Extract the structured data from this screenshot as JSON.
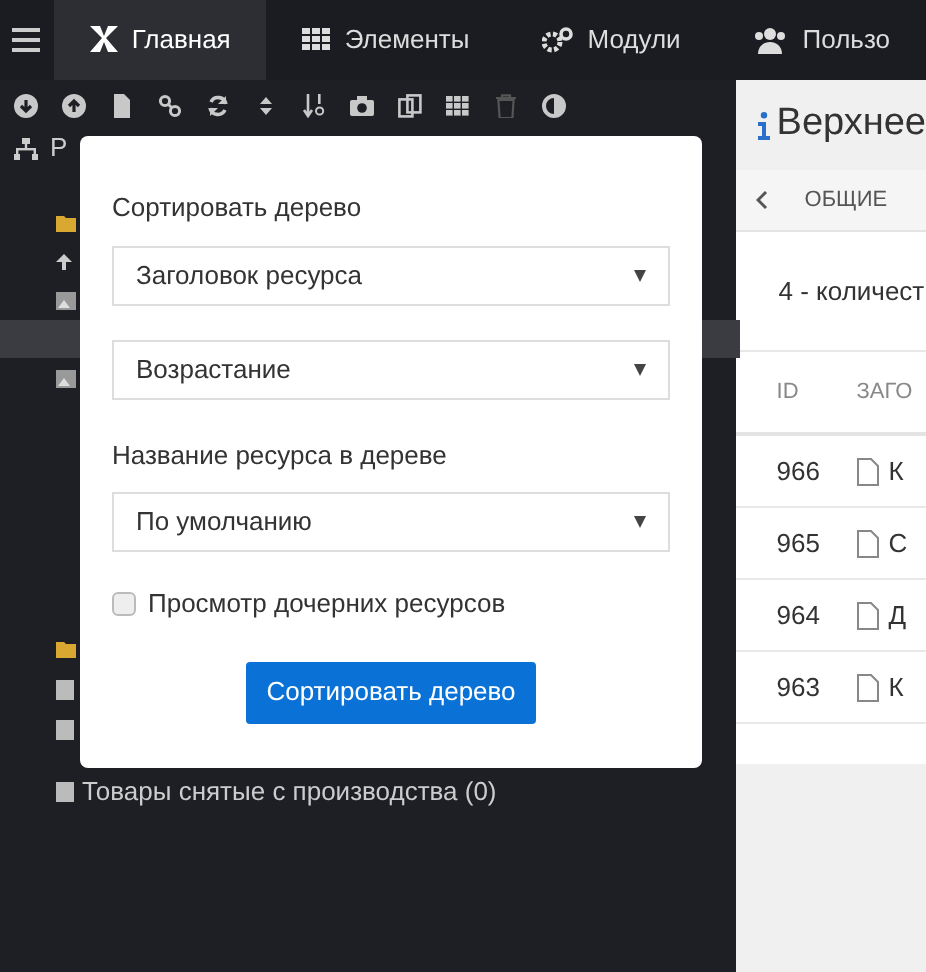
{
  "nav": {
    "tabs": [
      {
        "label": "Главная",
        "selected": true,
        "kind": "logo"
      },
      {
        "label": "Элементы",
        "selected": false,
        "kind": "grid"
      },
      {
        "label": "Модули",
        "selected": false,
        "kind": "gears"
      },
      {
        "label": "Пользо",
        "selected": false,
        "kind": "users"
      }
    ]
  },
  "toolbar": [
    {
      "kind": "down",
      "disabled": false
    },
    {
      "kind": "up",
      "disabled": false
    },
    {
      "kind": "file",
      "disabled": false
    },
    {
      "kind": "link",
      "disabled": false
    },
    {
      "kind": "refresh",
      "disabled": false
    },
    {
      "kind": "sort",
      "disabled": false
    },
    {
      "kind": "numsort",
      "disabled": false
    },
    {
      "kind": "camera",
      "disabled": false
    },
    {
      "kind": "copy",
      "disabled": false
    },
    {
      "kind": "grid",
      "disabled": false
    },
    {
      "kind": "trash",
      "disabled": true
    },
    {
      "kind": "contrast",
      "disabled": false
    }
  ],
  "tree": {
    "root": "Р",
    "items": [
      {
        "kind": "folder",
        "selected": false
      },
      {
        "kind": "upload",
        "selected": false
      },
      {
        "kind": "image",
        "selected": false
      },
      {
        "kind": "blank",
        "selected": true
      },
      {
        "kind": "image",
        "selected": false
      },
      {
        "kind": "folder",
        "selected": false
      },
      {
        "kind": "doc",
        "selected": false
      },
      {
        "kind": "doc",
        "selected": false
      }
    ],
    "last_item": "Товары снятые с производства (0)"
  },
  "panel": {
    "title": "Верхнее",
    "tabs": [
      {
        "label": "ОБЩИЕ",
        "selected": true
      }
    ],
    "summary": "4 - количест",
    "table": {
      "columns": [
        "ID",
        "ЗАГО"
      ],
      "rows": [
        [
          "966",
          "К"
        ],
        [
          "965",
          "С"
        ],
        [
          "964",
          "Д"
        ],
        [
          "963",
          "К"
        ]
      ]
    }
  },
  "dialog": {
    "title": "Сортировать дерево",
    "sort_field": "Заголовок ресурса",
    "sort_dir": "Возрастание",
    "name_label": "Название ресурса в дереве",
    "name_value": "По умолчанию",
    "checkbox": {
      "label": "Просмотр дочерних ресурсов",
      "checked": false
    },
    "button": "Сортировать дерево"
  }
}
